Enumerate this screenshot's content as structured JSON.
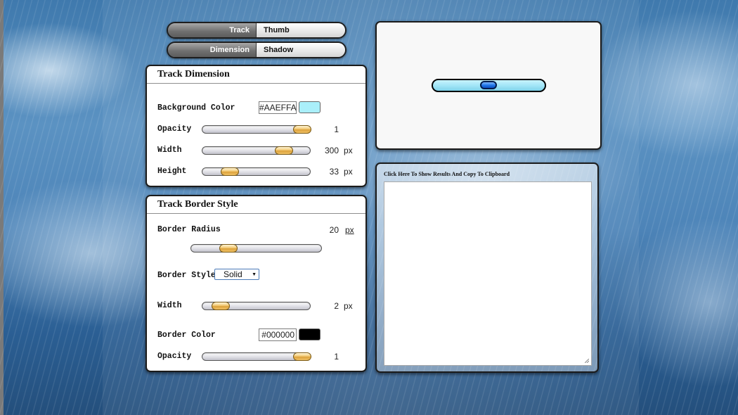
{
  "tabs": {
    "row1": {
      "active": "Track",
      "inactive": "Thumb"
    },
    "row2": {
      "active": "Dimension",
      "inactive": "Shadow"
    }
  },
  "track_dimension": {
    "title": "Track Dimension",
    "background_color": {
      "label": "Background Color",
      "value": "#AAEFFA",
      "swatch": "#AAEFFA"
    },
    "opacity": {
      "label": "Opacity",
      "value": "1",
      "level": 1.0
    },
    "width": {
      "label": "Width",
      "value": "300",
      "unit": "px",
      "level": 0.8
    },
    "height": {
      "label": "Height",
      "value": "33",
      "unit": "px",
      "level": 0.2
    }
  },
  "track_border_style": {
    "title": "Track Border Style",
    "border_radius": {
      "label": "Border Radius",
      "value": "20",
      "unit": "px",
      "level": 0.25
    },
    "border_style": {
      "label": "Border Style",
      "selected": "Solid"
    },
    "width": {
      "label": "Width",
      "value": "2",
      "unit": "px",
      "level": 0.1
    },
    "border_color": {
      "label": "Border Color",
      "value": "#000000",
      "swatch": "#000000"
    },
    "opacity": {
      "label": "Opacity",
      "value": "1",
      "level": 1.0
    }
  },
  "results": {
    "title": "Click Here To Show Results And Copy To Clipboard",
    "content": ""
  }
}
